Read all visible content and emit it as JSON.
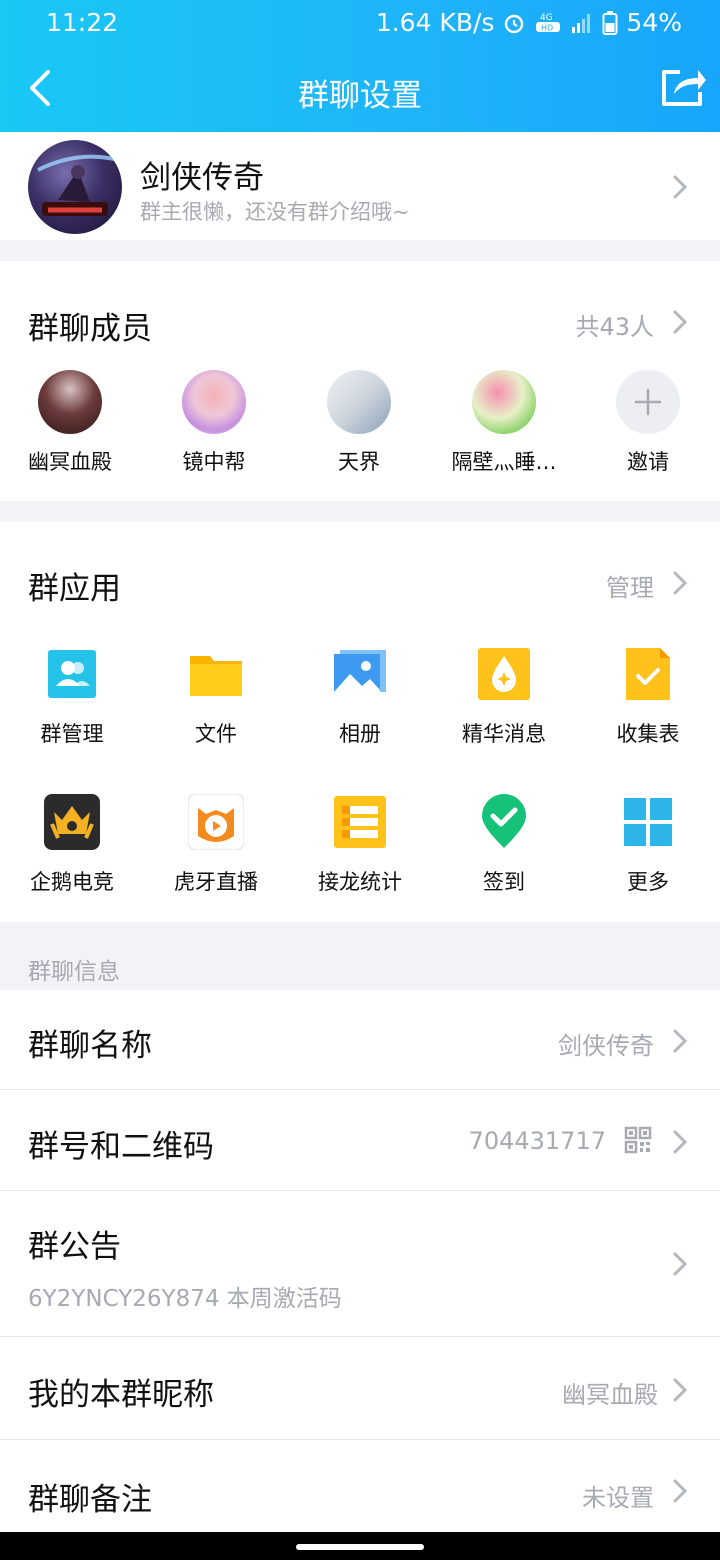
{
  "status": {
    "time": "11:22",
    "net_speed": "1.64 KB/s",
    "battery": "54%",
    "network": "4G"
  },
  "nav": {
    "title": "群聊设置"
  },
  "group": {
    "name": "剑侠传奇",
    "desc": "群主很懒，还没有群介绍哦~"
  },
  "members": {
    "title": "群聊成员",
    "count": "共43人",
    "list": [
      {
        "name": "幽冥血殿"
      },
      {
        "name": "镜中帮"
      },
      {
        "name": "天界"
      },
      {
        "name": "隔壁灬睡…"
      },
      {
        "name": "邀请"
      }
    ]
  },
  "apps": {
    "title": "群应用",
    "manage": "管理",
    "items": [
      {
        "label": "群管理",
        "icon": "group-manage-icon"
      },
      {
        "label": "文件",
        "icon": "folder-icon"
      },
      {
        "label": "相册",
        "icon": "album-icon"
      },
      {
        "label": "精华消息",
        "icon": "essence-icon"
      },
      {
        "label": "收集表",
        "icon": "collect-form-icon"
      },
      {
        "label": "企鹅电竞",
        "icon": "penguin-esports-icon"
      },
      {
        "label": "虎牙直播",
        "icon": "huya-live-icon"
      },
      {
        "label": "接龙统计",
        "icon": "chain-stats-icon"
      },
      {
        "label": "签到",
        "icon": "checkin-icon"
      },
      {
        "label": "更多",
        "icon": "more-grid-icon"
      }
    ]
  },
  "info": {
    "section_label": "群聊信息",
    "name_label": "群聊名称",
    "name_value": "剑侠传奇",
    "id_label": "群号和二维码",
    "id_value": "704431717",
    "notice_label": "群公告",
    "notice_value": "6Y2YNCY26Y874 本周激活码",
    "nickname_label": "我的本群昵称",
    "nickname_value": "幽冥血殿",
    "remark_label": "群聊备注",
    "remark_value": "未设置"
  },
  "colors": {
    "header_start": "#19c8f5",
    "header_end": "#17a6fb",
    "muted": "#a7a9b3"
  }
}
